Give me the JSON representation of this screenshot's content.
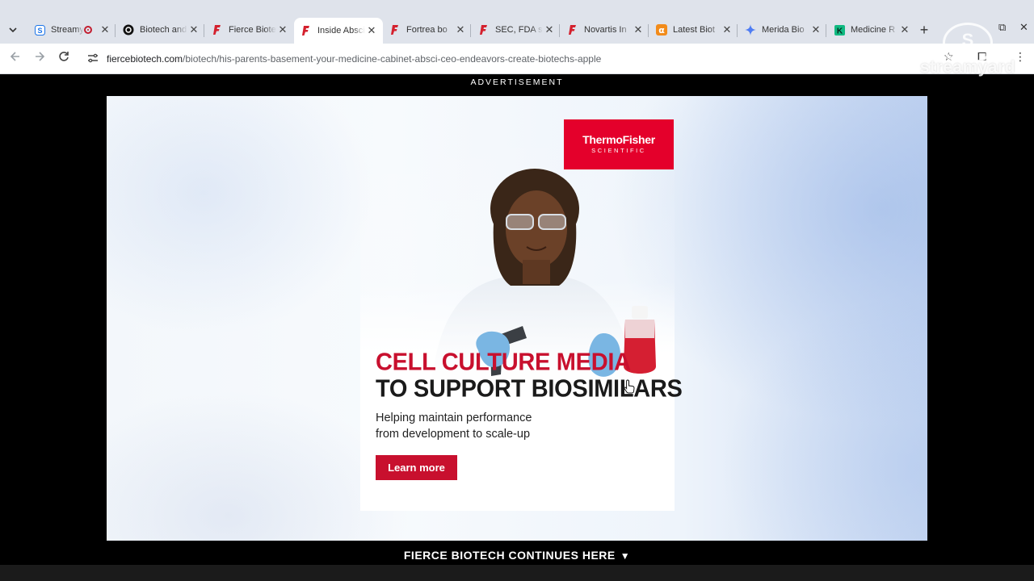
{
  "browser": {
    "tabs": [
      {
        "title": "Streamyard",
        "favicon": "S",
        "favicon_color": "#1a73e8",
        "recording": true
      },
      {
        "title": "Biotech and",
        "favicon": "circle-logo",
        "favicon_color": "#111111"
      },
      {
        "title": "Fierce Biotech",
        "favicon": "fierce-f",
        "favicon_color": "#d4212e"
      },
      {
        "title": "Inside Absci",
        "favicon": "fierce-f",
        "favicon_color": "#d4212e",
        "active": true
      },
      {
        "title": "Fortrea bo",
        "favicon": "fierce-f",
        "favicon_color": "#d4212e"
      },
      {
        "title": "SEC, FDA s",
        "favicon": "fierce-f",
        "favicon_color": "#d4212e"
      },
      {
        "title": "Novartis In",
        "favicon": "fierce-f",
        "favicon_color": "#d4212e"
      },
      {
        "title": "Latest Biot",
        "favicon": "α",
        "favicon_color": "#f28b1a"
      },
      {
        "title": "Merida Bio",
        "favicon": "gemini-star",
        "favicon_color": "#4f7df3"
      },
      {
        "title": "Medicine R",
        "favicon": "K",
        "favicon_color": "#10b981"
      }
    ],
    "address": {
      "host": "fiercebiotech.com",
      "path": "/biotech/his-parents-basement-your-medicine-cabinet-absci-ceo-endeavors-create-biotechs-apple"
    },
    "watermark": "streamyard"
  },
  "page": {
    "ad_label": "ADVERTISEMENT",
    "ad": {
      "brand_line1": "ThermoFisher",
      "brand_line2": "SCIENTIFIC",
      "brand_color": "#e4002b",
      "headline_red": "CELL CULTURE MEDIA",
      "headline_dark": "TO SUPPORT BIOSIMILARS",
      "sub_line1": "Helping maintain performance",
      "sub_line2": "from development to scale-up",
      "cta": "Learn more"
    },
    "continue_text": "FIERCE BIOTECH CONTINUES HERE",
    "continue_arrow": "▼"
  }
}
